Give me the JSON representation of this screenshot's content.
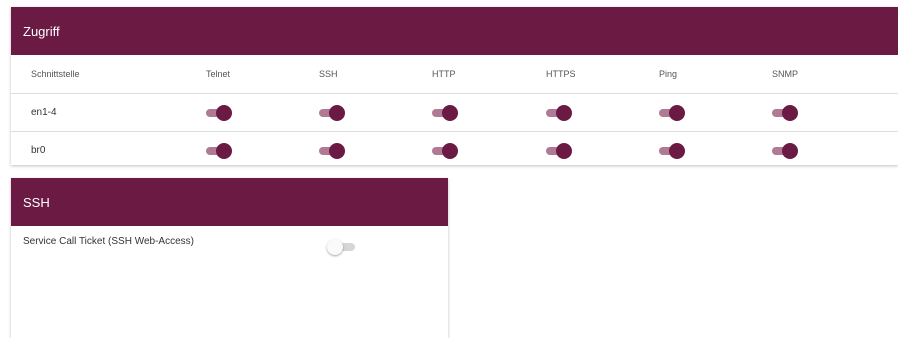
{
  "access": {
    "title": "Zugriff",
    "columns": [
      "Schnittstelle",
      "Telnet",
      "SSH",
      "HTTP",
      "HTTPS",
      "Ping",
      "SNMP"
    ],
    "rows": [
      {
        "interface": "en1-4",
        "telnet": true,
        "ssh": true,
        "http": true,
        "https": true,
        "ping": true,
        "snmp": true
      },
      {
        "interface": "br0",
        "telnet": true,
        "ssh": true,
        "http": true,
        "https": true,
        "ping": true,
        "snmp": true
      }
    ]
  },
  "ssh": {
    "title": "SSH",
    "service_call_label": "Service Call Ticket (SSH Web-Access)",
    "service_call_enabled": false
  },
  "colors": {
    "header_bg": "#6b1a43",
    "toggle_on_knob": "#6b1a43",
    "toggle_on_track": "#b07a95",
    "toggle_off_track": "#d6d6d6"
  }
}
